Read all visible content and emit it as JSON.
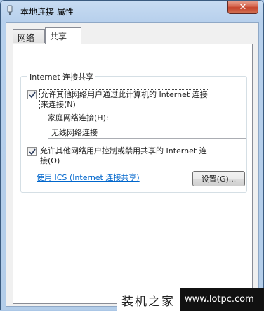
{
  "window": {
    "title": "本地连接 属性",
    "close_label": "✕"
  },
  "tabs": [
    {
      "label": "网络"
    },
    {
      "label": "共享"
    }
  ],
  "sharing": {
    "group_title": "Internet 连接共享",
    "allow_connect": {
      "line1": "允许其他网络用户通过此计算机的 Internet 连接",
      "line2": "来连接(N)",
      "checked": true
    },
    "home_network_label": "家庭网络连接(H):",
    "home_network_value": "无线网络连接",
    "allow_control": {
      "line1": "允许其他网络用户控制或禁用共享的 Internet 连",
      "line2": "接(O)",
      "checked": true
    },
    "ics_link": "使用 ICS (Internet 连接共享)",
    "settings_button": "设置(G)..."
  },
  "watermark": {
    "brand": "装机之家",
    "url": "www.lotpc.com"
  }
}
